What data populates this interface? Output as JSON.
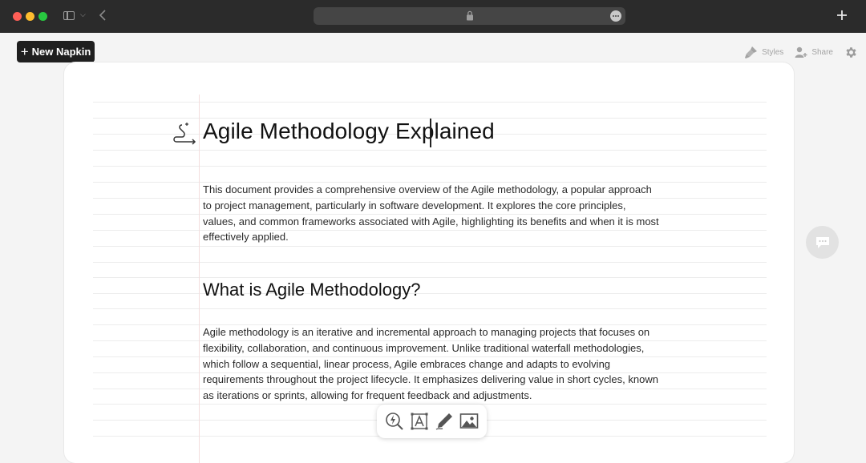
{
  "toolbar": {
    "new_napkin_label": "New Napkin",
    "styles_label": "Styles",
    "share_label": "Share"
  },
  "document": {
    "title": "Agile Methodology Explained",
    "intro": "This document provides a comprehensive overview of the Agile methodology, a popular approach to project management, particularly in software development. It explores the core principles, values, and common frameworks associated with Agile, highlighting its benefits and when it is most effectively applied.",
    "section_heading": "What is Agile Methodology?",
    "section_body": "Agile methodology is an iterative and incremental approach to managing projects that focuses on flexibility, collaboration, and continuous improvement. Unlike traditional waterfall methodologies, which follow a sequential, linear process, Agile embraces change and adapts to evolving requirements throughout the project lifecycle. It emphasizes delivering value in short cycles, known as iterations or sprints, allowing for frequent feedback and adjustments."
  },
  "icons": {
    "generate": "sparkle-generate-icon",
    "comment": "comment-icon",
    "tools": [
      "lightning-search-icon",
      "text-box-icon",
      "pen-icon",
      "image-icon"
    ]
  },
  "colors": {
    "chrome_bg": "#2b2b2b",
    "button_dark": "#1f1f1f",
    "page_bg": "#f4f4f4",
    "card_bg": "#ffffff",
    "rule": "#ececec"
  }
}
